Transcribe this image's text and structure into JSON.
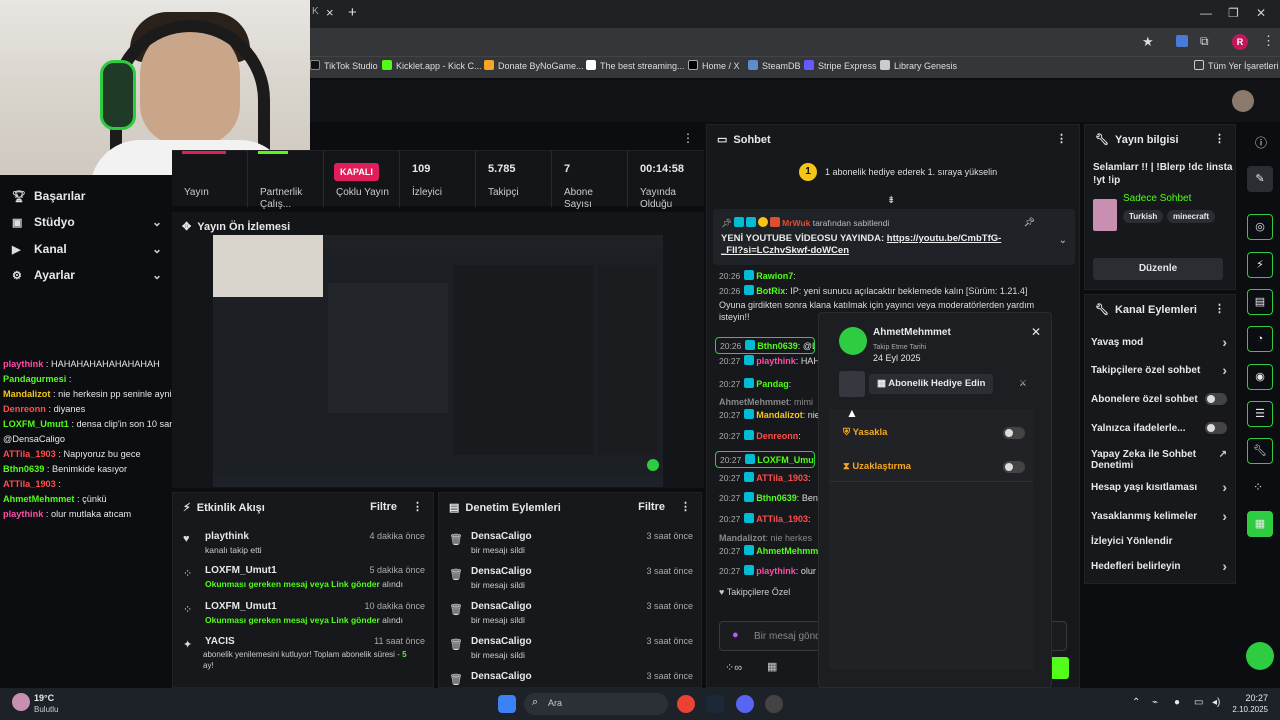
{
  "browser": {
    "bookmarks": [
      "TikTok Studio",
      "Kicklet.app - Kick C...",
      "Donate ByNoGame...",
      "The best streaming...",
      "Home / X",
      "SteamDB",
      "Stripe Express",
      "Library Genesis"
    ],
    "all_bookmarks": "Tüm Yer İşaretleri",
    "profile_initial": "R",
    "new_tab": "+",
    "close_tab": "×"
  },
  "nav": {
    "items": [
      {
        "label": "Başarılar",
        "icon": "trophy-icon"
      },
      {
        "label": "Stüdyo",
        "icon": "studio-icon"
      },
      {
        "label": "Kanal",
        "icon": "channel-icon"
      },
      {
        "label": "Ayarlar",
        "icon": "gear-icon"
      }
    ]
  },
  "left_chat": [
    {
      "user": "playthink",
      "color": "#ff4da6",
      "text": "HAHAHAHAHAHAHAHAH"
    },
    {
      "user": "Pandagurmesi",
      "color": "#53fc18",
      "text": ""
    },
    {
      "user": "Mandalizot",
      "color": "#f5c518",
      "text": "nie herkesin pp seninle ayniaq jshsjs"
    },
    {
      "user": "Denreonn",
      "color": "#ff4d4d",
      "text": "diyanes"
    },
    {
      "user": "LOXFM_Umut1",
      "color": "#53fc18",
      "text": "densa clip'in son 10 saniyesine bak"
    },
    {
      "user": "",
      "color": "#e8e8e8",
      "text": "@DensaCaligo"
    },
    {
      "user": "ATTila_1903",
      "color": "#ff4d4d",
      "text": "Napıyoruz bu gece"
    },
    {
      "user": "Bthn0639",
      "color": "#53fc18",
      "text": "Benimkide kasıyor"
    },
    {
      "user": "ATTila_1903",
      "color": "#ff4d4d",
      "text": ""
    },
    {
      "user": "AhmetMehmmet",
      "color": "#53fc18",
      "text": "çünkü"
    },
    {
      "user": "playthink",
      "color": "#ff4da6",
      "text": "olur mutlaka atıcam"
    }
  ],
  "stats": {
    "yayin": "Yayın",
    "partnerlik": "Partnerlik Çalış...",
    "kapali": "KAPALI",
    "coklu": "Çoklu Yayın",
    "izleyici_v": "109",
    "izleyici_l": "İzleyici",
    "takipci_v": "5.785",
    "takipci_l": "Takipçi",
    "abone_v": "7",
    "abone_l": "Abone Sayısı",
    "sure_v": "00:14:58",
    "sure_l": "Yayında Olduğu"
  },
  "preview": {
    "title": "Yayın Ön İzlemesi"
  },
  "activity": {
    "title": "Etkinlik Akışı",
    "filter": "Filtre",
    "rows": [
      {
        "name": "playthink",
        "time": "4 dakika önce",
        "sub": "kanalı takip etti",
        "icon": "heart-icon"
      },
      {
        "name": "LOXFM_Umut1",
        "time": "5 dakika önce",
        "sub_green": "Okunması gereken mesaj veya Link gönder",
        "sub_rest": " alındı",
        "icon": "points-icon"
      },
      {
        "name": "LOXFM_Umut1",
        "time": "10 dakika önce",
        "sub_green": "Okunması gereken mesaj veya Link gönder",
        "sub_rest": " alındı",
        "icon": "points-icon"
      },
      {
        "name": "YACIS",
        "time": "11 saat önce",
        "sub": "abonelik yenilemesini kutluyor! Toplam abonelik süresi - ",
        "sub_green": "5",
        "sub2": "ay!",
        "icon": "star-icon"
      }
    ]
  },
  "modlog": {
    "title": "Denetim Eylemleri",
    "filter": "Filtre",
    "rows": [
      {
        "name": "DensaCaligo",
        "time": "3 saat önce",
        "sub": "bir mesajı sildi"
      },
      {
        "name": "DensaCaligo",
        "time": "3 saat önce",
        "sub": "bir mesajı sildi"
      },
      {
        "name": "DensaCaligo",
        "time": "3 saat önce",
        "sub": "bir mesajı sildi"
      },
      {
        "name": "DensaCaligo",
        "time": "3 saat önce",
        "sub": "bir mesajı sildi"
      },
      {
        "name": "DensaCaligo",
        "time": "3 saat önce",
        "sub": ""
      }
    ]
  },
  "chat": {
    "title": "Sohbet",
    "gift_banner": "1 abonelik hediye ederek 1. sıraya yükselin",
    "gift_count": "1",
    "pinned_by": "tarafından sabitlendi",
    "pinned_text": "YENİ YOUTUBE VİDEOSU YAYINDA: ",
    "pinned_link": "https://youtu.be/CmbTfG-_FII?si=LCzhvSkwf-doWCen",
    "messages": [
      {
        "time": "20:26",
        "user": "Rawion7",
        "color": "#53fc18",
        "text": ""
      },
      {
        "time": "20:26",
        "user": "BotRix",
        "color": "#53fc18",
        "text": "IP: yeni sunucu açılacaktır beklemede kalın [Sürüm: 1.21.4]"
      },
      {
        "time": "",
        "user": "",
        "color": "#ddd",
        "text": "Oyuna girdikten sonra klana katılmak için yayıncı veya moderatörlerden yardım"
      },
      {
        "time": "",
        "user": "",
        "color": "#ddd",
        "text": "isteyin!!"
      },
      {
        "time": "20:26",
        "user": "Bthn0639",
        "color": "#53fc18",
        "text": "@L"
      },
      {
        "time": "20:27",
        "user": "playthink",
        "color": "#ff4da6",
        "text": "HAHAH"
      },
      {
        "time": "20:27",
        "user": "Pandag",
        "color": "#53fc18",
        "text": ""
      },
      {
        "time": "",
        "user": "AhmetMehmmet",
        "color": "#888",
        "text": "mimi"
      },
      {
        "time": "20:27",
        "user": "Mandalizot",
        "color": "#f5c518",
        "text": "nie"
      },
      {
        "time": "20:27",
        "user": "Denreonn",
        "color": "#ff4d4d",
        "text": ""
      },
      {
        "time": "20:27",
        "user": "LOXFM_Umut1",
        "color": "#53fc18",
        "text": "de"
      },
      {
        "time": "20:27",
        "user": "ATTila_1903",
        "color": "#ff4d4d",
        "text": ""
      },
      {
        "time": "20:27",
        "user": "Bthn0639",
        "color": "#53fc18",
        "text": "Ben"
      },
      {
        "time": "20:27",
        "user": "ATTila_1903",
        "color": "#ff4d4d",
        "text": ""
      },
      {
        "time": "",
        "user": "Mandalizot",
        "color": "#888",
        "text": "nie herkes"
      },
      {
        "time": "20:27",
        "user": "AhmetMehmmet",
        "color": "#53fc18",
        "text": ""
      },
      {
        "time": "20:27",
        "user": "playthink",
        "color": "#ff4da6",
        "text": "olur mu"
      }
    ],
    "followers_only": "Takipçilere Özel",
    "input_placeholder": "Bir mesaj gönd"
  },
  "popup": {
    "username": "AhmetMehmmet",
    "follow_label": "Takip Etme Tarihi",
    "follow_date": "24 Eyl 2025",
    "gift_btn": "Abonelik Hediye Edin",
    "ban": "Yasakla",
    "timeout": "Uzaklaştırma"
  },
  "stream_info": {
    "title": "Yayın bilgisi",
    "text": "Selamlarr !! | !Blerp !dc !insta !yt !ip",
    "category": "Sadece Sohbet",
    "tags": [
      "Turkish",
      "minecraft"
    ],
    "edit": "Düzenle"
  },
  "channel_actions": {
    "title": "Kanal Eylemleri",
    "rows": [
      {
        "label": "Yavaş mod",
        "type": "chev"
      },
      {
        "label": "Takipçilere özel sohbet",
        "type": "chev"
      },
      {
        "label": "Abonelere özel sohbet",
        "type": "toggle"
      },
      {
        "label": "Yalnızca ifadelerle...",
        "type": "toggle"
      },
      {
        "label": "Yapay Zeka ile Sohbet Denetimi",
        "type": "ext"
      },
      {
        "label": "Hesap yaşı kısıtlaması",
        "type": "chev"
      },
      {
        "label": "Yasaklanmış kelimeler",
        "type": "chev"
      },
      {
        "label": "İzleyici Yönlendir",
        "type": "none"
      },
      {
        "label": "Hedefleri belirleyin",
        "type": "chev"
      }
    ]
  },
  "taskbar": {
    "temp": "19°C",
    "weather": "Bulutlu",
    "search": "Ara",
    "time": "20:27",
    "date": "2.10.2025"
  },
  "colors": {
    "accent": "#53fc18",
    "danger": "#e01e5a",
    "panel": "#16181c"
  }
}
